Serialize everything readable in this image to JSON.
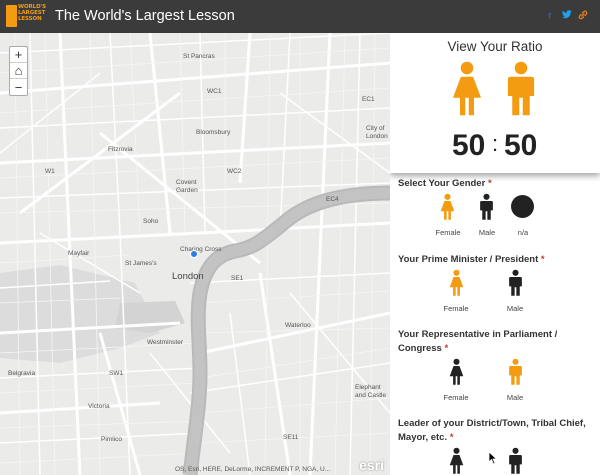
{
  "header": {
    "logo_text": "WORLD'S LARGEST LESSON",
    "title": "The World's Largest Lesson",
    "social": [
      "facebook-icon",
      "twitter-icon",
      "link-icon"
    ],
    "colors": {
      "bar": "#3b3b3b",
      "accent": "#f39c12",
      "facebook": "#3b5998",
      "twitter": "#1da1f2",
      "link": "#e67e22"
    }
  },
  "map": {
    "zoom_in": "+",
    "home": "⌂",
    "zoom_out": "−",
    "labels": {
      "st_pancras": "St Pancras",
      "wc1": "WC1",
      "ec1": "EC1",
      "fitzrovia": "Fitzrovia",
      "bloomsbury": "Bloomsbury",
      "city_of_london": "City of London",
      "w1": "W1",
      "covent_garden": "Covent Garden",
      "wc2": "WC2",
      "ec4": "EC4",
      "soho": "Soho",
      "mayfair": "Mayfair",
      "st_james": "St James's",
      "charing_cross": "Charing Cross",
      "london": "London",
      "se1": "SE1",
      "waterloo": "Waterloo",
      "westminster": "Westminster",
      "belgravia": "Belgravia",
      "sw1": "SW1",
      "victoria": "Victoria",
      "elephant_castle": "Elephant and Castle",
      "pimlico": "Pimlico",
      "se11": "SE11"
    },
    "attribution": "OS, Esri, HERE, DeLorme, INCREMENT P, NGA, U...",
    "esri": "esri"
  },
  "panel": {
    "ratio_title": "View Your Ratio",
    "ratio_left": "50",
    "ratio_colon": ":",
    "ratio_right": "50",
    "required_marker": "*",
    "questions": [
      {
        "label": "Select Your Gender",
        "options": [
          "Female",
          "Male",
          "n/a"
        ],
        "selected": "Female"
      },
      {
        "label": "Your Prime Minister / President",
        "options": [
          "Female",
          "Male"
        ],
        "selected": "Female"
      },
      {
        "label": "Your Representative in Parliament / Congress",
        "options": [
          "Female",
          "Male"
        ],
        "selected": "Male"
      },
      {
        "label": "Leader of your District/Town, Tribal Chief, Mayor, etc.",
        "options": [
          "Female",
          "Male"
        ],
        "selected": ""
      }
    ],
    "colors": {
      "selected": "#f39c12",
      "unselected": "#222222"
    }
  }
}
